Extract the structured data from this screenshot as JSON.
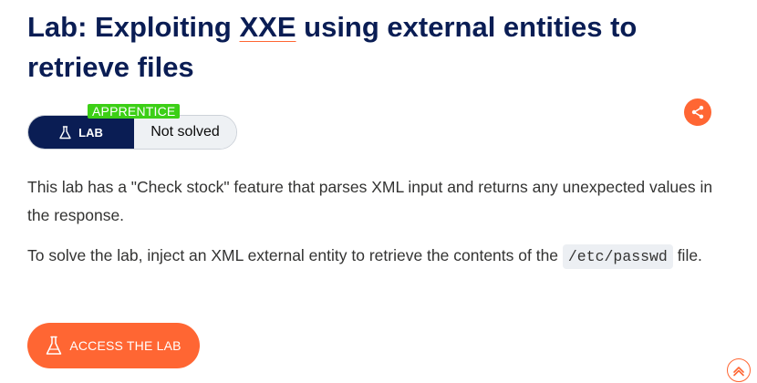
{
  "title": {
    "prefix": "Lab: Exploiting ",
    "highlight": "XXE",
    "suffix": " using external entities to retrieve files"
  },
  "badge": {
    "level": "APPRENTICE",
    "lab_label": "LAB",
    "status": "Not solved"
  },
  "description": {
    "paragraph1": "This lab has a \"Check stock\" feature that parses XML input and returns any unexpected values in the response.",
    "paragraph2_before": "To solve the lab, inject an XML external entity to retrieve the contents of the ",
    "paragraph2_code": "/etc/passwd",
    "paragraph2_after": " file."
  },
  "actions": {
    "access_label": "ACCESS THE LAB"
  },
  "icons": {
    "share": "share-icon",
    "flask": "flask-icon",
    "scroll_top": "chevron-up-icon"
  },
  "colors": {
    "title": "#0a1d54",
    "accent": "#ff6633",
    "level_badge": "#3ccf16",
    "text": "#333332"
  }
}
